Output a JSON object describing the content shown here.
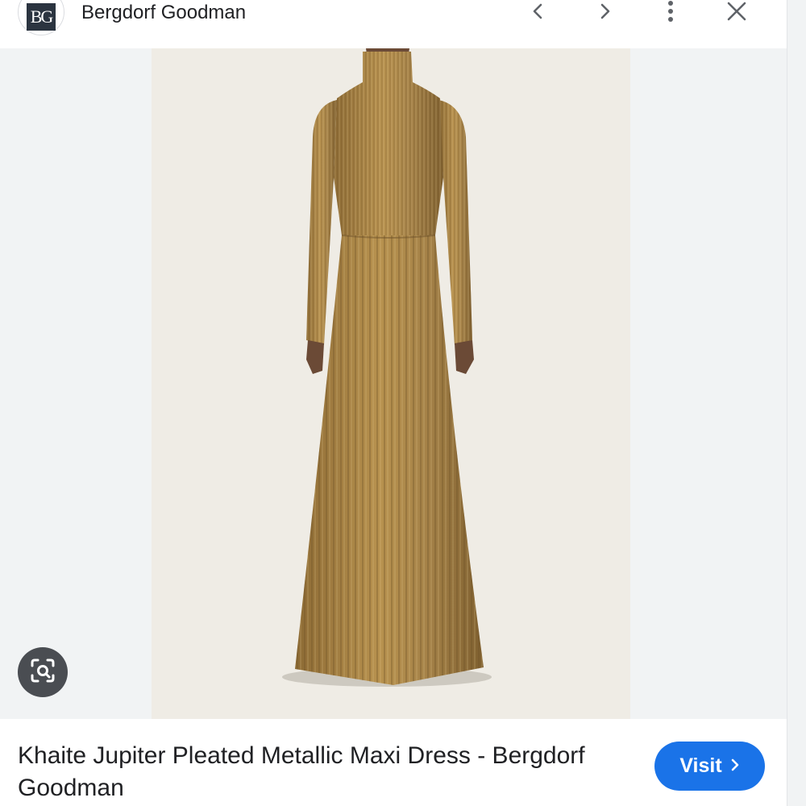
{
  "header": {
    "logo_text": "BG",
    "site_name": "Bergdorf Goodman",
    "icons": {
      "prev": "chevron-left-icon",
      "next": "chevron-right-icon",
      "more": "more-vert-icon",
      "close": "close-icon"
    }
  },
  "viewer": {
    "lens_icon": "lens-search-icon"
  },
  "result": {
    "title": "Khaite Jupiter Pleated Metallic Maxi Dress - Bergdorf Goodman",
    "visit_label": "Visit",
    "visit_icon": "chevron-right-icon"
  },
  "colors": {
    "accent": "#1a73e8",
    "background": "#f1f3f4",
    "dress": "#a8844a"
  }
}
